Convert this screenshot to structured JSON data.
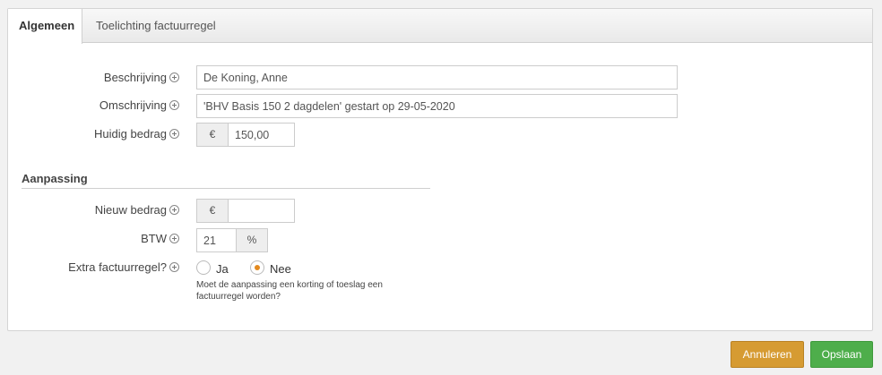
{
  "tabs": [
    {
      "label": "Algemeen",
      "active": true
    },
    {
      "label": "Toelichting factuurregel",
      "active": false
    }
  ],
  "fields": {
    "beschrijving": {
      "label": "Beschrijving",
      "value": "De Koning, Anne"
    },
    "omschrijving": {
      "label": "Omschrijving",
      "value": "'BHV Basis 150 2 dagdelen' gestart op 29-05-2020"
    },
    "huidig_bedrag": {
      "label": "Huidig bedrag",
      "currency": "€",
      "value": "150,00"
    }
  },
  "aanpassing": {
    "title": "Aanpassing",
    "nieuw_bedrag": {
      "label": "Nieuw bedrag",
      "currency": "€",
      "value": ""
    },
    "btw": {
      "label": "BTW",
      "value": "21",
      "unit": "%"
    },
    "extra": {
      "label": "Extra factuurregel?",
      "options": [
        "Ja",
        "Nee"
      ],
      "selected": "Nee",
      "help": "Moet de aanpassing een korting of toeslag een factuurregel worden?"
    }
  },
  "buttons": {
    "cancel": "Annuleren",
    "save": "Opslaan"
  },
  "colors": {
    "cancel": "#d69b32",
    "save": "#4eae4b",
    "radio_dot": "#e38a1f"
  }
}
